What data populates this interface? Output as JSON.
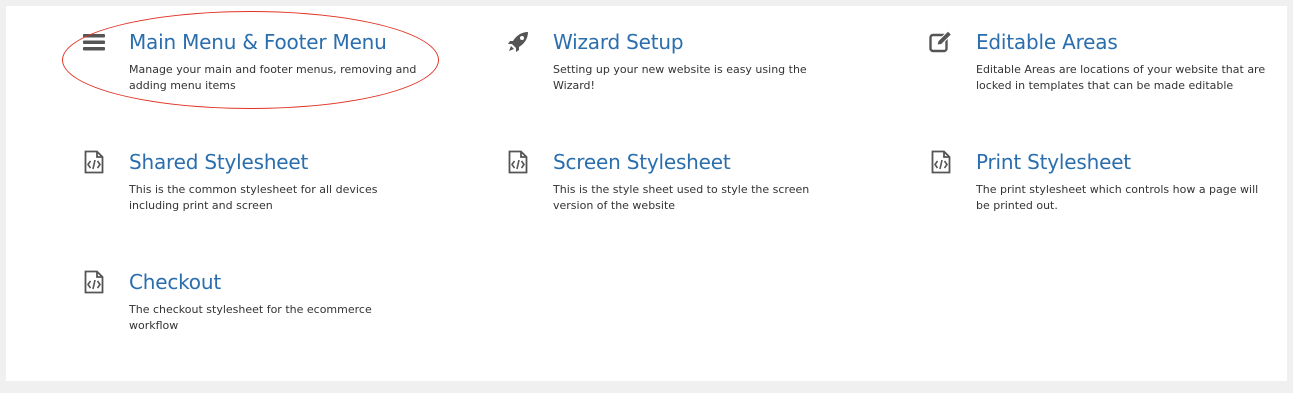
{
  "tiles": [
    {
      "title": "Main Menu & Footer Menu",
      "description": "Manage your main and footer menus, removing and adding menu items",
      "icon": "hamburger-icon"
    },
    {
      "title": "Wizard Setup",
      "description": "Setting up your new website is easy using the Wizard!",
      "icon": "rocket-icon"
    },
    {
      "title": "Editable Areas",
      "description": "Editable Areas are locations of your website that are locked in templates that can be made editable",
      "icon": "edit-icon"
    },
    {
      "title": "Shared Stylesheet",
      "description": "This is the common stylesheet for all devices including print and screen",
      "icon": "code-file-icon"
    },
    {
      "title": "Screen Stylesheet",
      "description": "This is the style sheet used to style the screen version of the website",
      "icon": "code-file-icon"
    },
    {
      "title": "Print Stylesheet",
      "description": "The print stylesheet which controls how a page will be printed out.",
      "icon": "code-file-icon"
    },
    {
      "title": "Checkout",
      "description": "The checkout stylesheet for the ecommerce workflow",
      "icon": "code-file-icon"
    }
  ],
  "colors": {
    "title": "#2a6ead",
    "icon": "#555555",
    "highlight": "#e03324"
  }
}
